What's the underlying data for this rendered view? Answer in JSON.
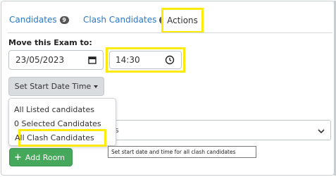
{
  "tabs": [
    {
      "label": "Candidates",
      "badge": "9"
    },
    {
      "label": "Clash Candidates",
      "badge": "9"
    },
    {
      "label": "Actions"
    }
  ],
  "move_exam": {
    "label": "Move this Exam to:",
    "date_value": "23/05/2023",
    "time_value": "14:30"
  },
  "start_button": {
    "label": "Set Start Date Time"
  },
  "dropdown_menu": {
    "items": [
      "All Listed candidates",
      "0 Selected Candidates",
      "All Clash Candidates"
    ]
  },
  "select": {
    "visible_value": "s"
  },
  "add_room": {
    "label": "Add Room"
  },
  "tooltip": {
    "text": "Set start date and time for all clash candidates"
  },
  "colors": {
    "highlight": "#ffeb0b",
    "tab_link": "#2a78c5",
    "badge": "#555555",
    "add_button": "#45a85a",
    "button_gray": "#d9dcdf"
  },
  "icons": {
    "date": "calendar-icon",
    "time": "clock-icon",
    "select": "chevron-down-icon",
    "add": "plus-icon"
  }
}
